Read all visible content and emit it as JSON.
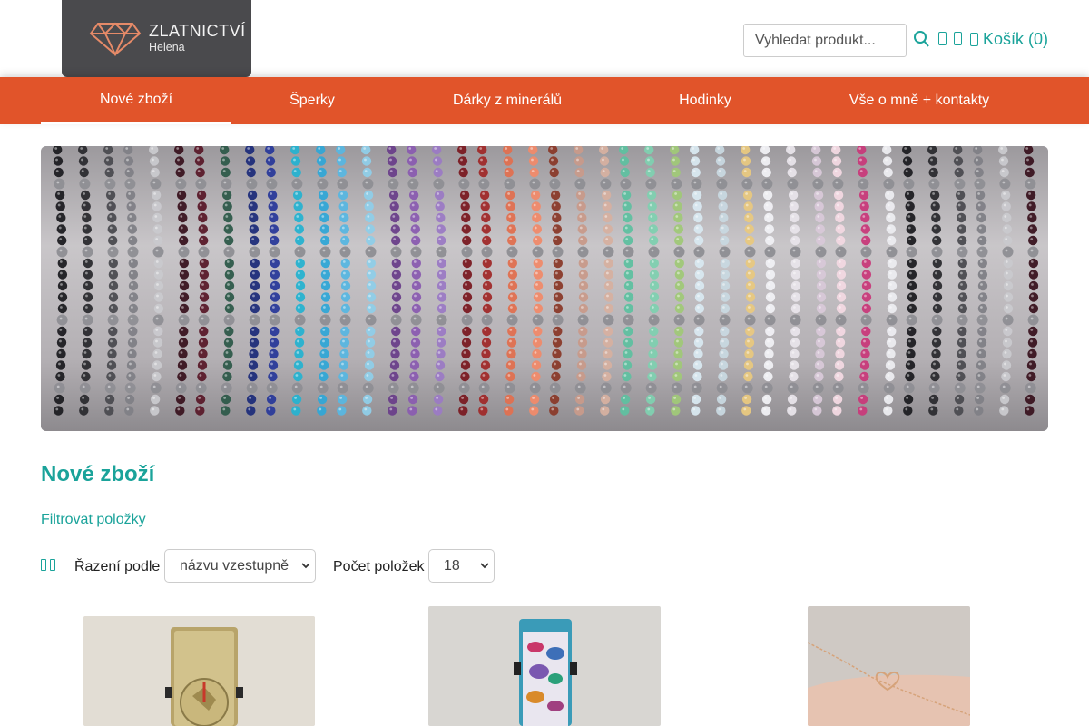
{
  "header": {
    "logo_title": "ZLATNICTVÍ",
    "logo_subtitle": "Helena",
    "search_placeholder": "Vyhledat produkt...",
    "cart_label": "Košík (0)",
    "icons": [
      "search-icon",
      "user-icon",
      "heart-icon",
      "cart-icon"
    ]
  },
  "nav": {
    "items": [
      {
        "label": "Nové zboží",
        "active": true
      },
      {
        "label": "Šperky",
        "active": false
      },
      {
        "label": "Dárky z minerálů",
        "active": false
      },
      {
        "label": "Hodinky",
        "active": false
      },
      {
        "label": "Vše o mně + kontakty",
        "active": false
      }
    ]
  },
  "main": {
    "title": "Nové zboží",
    "filter_link": "Filtrovat položky",
    "sort_label": "Řazení podle",
    "sort_value": "názvu vzestupně",
    "count_label": "Počet položek",
    "count_value": "18"
  },
  "colors": {
    "accent": "#1aa39a",
    "nav_bg": "#e1542a",
    "logo_bg": "#4a4a4d",
    "logo_diamond": "#e58a68"
  }
}
